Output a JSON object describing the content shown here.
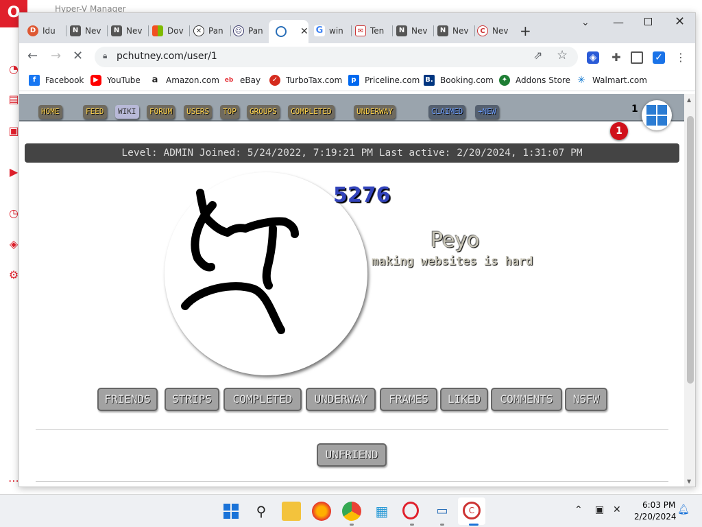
{
  "background_app": {
    "title": "Hyper-V Manager"
  },
  "tabs": [
    {
      "label": "Idu",
      "icon": "duckduckgo-icon"
    },
    {
      "label": "Nev",
      "icon": "notion-icon"
    },
    {
      "label": "Nev",
      "icon": "notion-icon"
    },
    {
      "label": "Dov",
      "icon": "microsoft-icon"
    },
    {
      "label": "Pan",
      "icon": "pan-icon"
    },
    {
      "label": "Pan",
      "icon": "pan-icon"
    },
    {
      "label": "",
      "icon": "loading-icon",
      "active": true
    },
    {
      "label": "win",
      "icon": "google-icon"
    },
    {
      "label": "Ten",
      "icon": "mail-icon"
    },
    {
      "label": "Nev",
      "icon": "notion-icon"
    },
    {
      "label": "Nev",
      "icon": "notion-icon"
    },
    {
      "label": "Nev",
      "icon": "nev-icon"
    }
  ],
  "address_bar": {
    "url": "pchutney.com/user/1"
  },
  "bookmarks": [
    {
      "label": "Facebook",
      "icon": "facebook-icon",
      "color": "#1877f2"
    },
    {
      "label": "YouTube",
      "icon": "youtube-icon",
      "color": "#ff0000"
    },
    {
      "label": "Amazon.com",
      "icon": "amazon-icon",
      "color": "#222222"
    },
    {
      "label": "eBay",
      "icon": "ebay-icon",
      "color": "#e53238"
    },
    {
      "label": "TurboTax.com",
      "icon": "turbotax-icon",
      "color": "#d52b1e"
    },
    {
      "label": "Priceline.com",
      "icon": "priceline-icon",
      "color": "#0068ef"
    },
    {
      "label": "Booking.com",
      "icon": "booking-icon",
      "color": "#003580"
    },
    {
      "label": "Addons Store",
      "icon": "addons-icon",
      "color": "#1e7e34"
    },
    {
      "label": "Walmart.com",
      "icon": "walmart-icon",
      "color": "#0071ce"
    }
  ],
  "site_nav": [
    {
      "label": "HOME"
    },
    {
      "label": "FEED"
    },
    {
      "label": "WIKI"
    },
    {
      "label": "FORUM"
    },
    {
      "label": "USERS"
    },
    {
      "label": "TOP"
    },
    {
      "label": "GROUPS"
    },
    {
      "label": "COMPLETED"
    },
    {
      "label": "UNDERWAY"
    },
    {
      "label": "CLAIMED"
    },
    {
      "label": "+NEW"
    }
  ],
  "notifications": {
    "count": "1",
    "badge": "1"
  },
  "profile": {
    "status_line": "Level: ADMIN Joined: 5/24/2022, 7:19:21 PM Last active: 2/20/2024, 1:31:07 PM",
    "points": "5276",
    "username": "Peyo",
    "tagline": "making websites is hard"
  },
  "profile_buttons": [
    {
      "label": "FRIENDS"
    },
    {
      "label": "STRIPS"
    },
    {
      "label": "COMPLETED"
    },
    {
      "label": "UNDERWAY"
    },
    {
      "label": "FRAMES"
    },
    {
      "label": "LIKED"
    },
    {
      "label": "COMMENTS"
    },
    {
      "label": "NSFW"
    }
  ],
  "unfriend_label": "UNFRIEND",
  "taskbar": {
    "time": "6:03 PM",
    "date": "2/20/2024"
  },
  "colors": {
    "nav_text": "#ffd24a",
    "points": "#3344bb",
    "badge": "#d0101a"
  }
}
